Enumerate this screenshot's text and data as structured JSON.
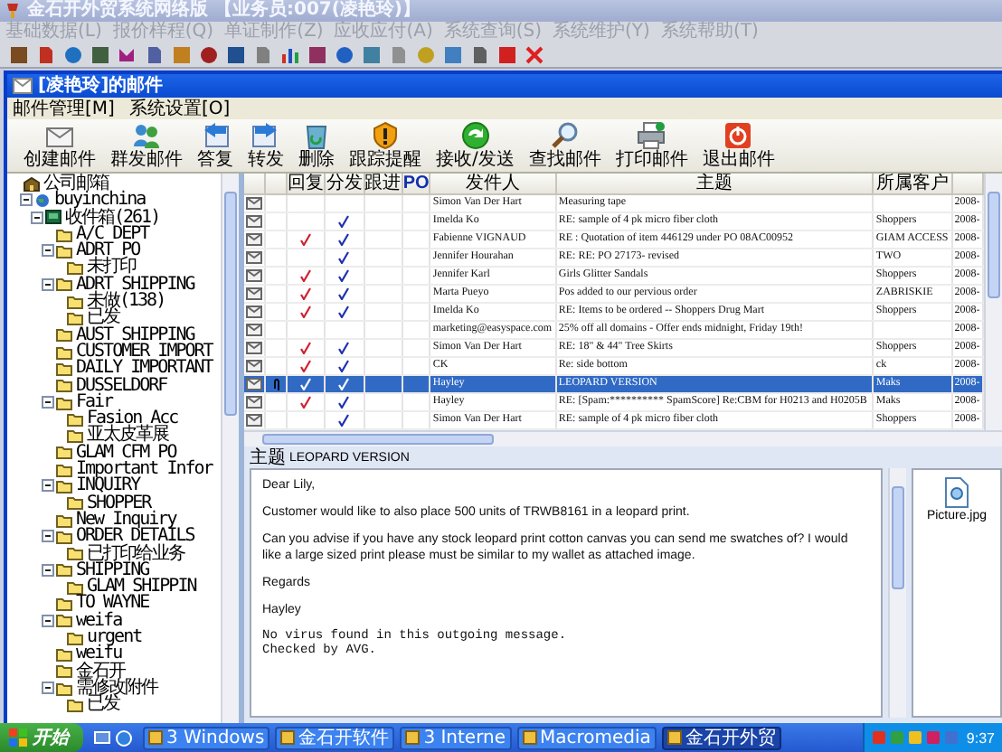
{
  "window": {
    "title": "金石开外贸系统网络版 【业务员:007(凌艳玲)】"
  },
  "menu": [
    {
      "label": "基础数据(L)",
      "disabled": true
    },
    {
      "label": "报价样程(Q)",
      "disabled": true
    },
    {
      "label": "单证制作(Z)",
      "disabled": true
    },
    {
      "label": "应收应付(A)",
      "disabled": true
    },
    {
      "label": "系统查询(S)",
      "disabled": true
    },
    {
      "label": "系统维护(Y)",
      "disabled": true
    },
    {
      "label": "系统帮助(T)",
      "disabled": true
    }
  ],
  "mail_window": {
    "title": "[凌艳玲]的邮件",
    "menu": [
      "邮件管理[M]",
      "系统设置[O]"
    ],
    "toolbar": [
      "创建邮件",
      "群发邮件",
      "答复",
      "转发",
      "删除",
      "跟踪提醒",
      "接收/发送",
      "查找邮件",
      "打印邮件",
      "退出邮件"
    ]
  },
  "tree": [
    {
      "label": "公司邮箱",
      "kind": "root",
      "children": [
        {
          "label": "buyinchina",
          "kind": "account",
          "expanded": true,
          "children": [
            {
              "label": "收件箱(261)",
              "kind": "inbox",
              "expanded": true,
              "children": [
                {
                  "label": "A/C DEPT",
                  "kind": "folder"
                },
                {
                  "label": "ADRT PO",
                  "kind": "folder",
                  "expanded": true,
                  "children": [
                    {
                      "label": "未打印",
                      "kind": "folder"
                    }
                  ]
                },
                {
                  "label": "ADRT SHIPPING",
                  "kind": "folder",
                  "expanded": true,
                  "children": [
                    {
                      "label": "未做(138)",
                      "kind": "folder"
                    },
                    {
                      "label": "已发",
                      "kind": "folder"
                    }
                  ]
                },
                {
                  "label": "AUST SHIPPING",
                  "kind": "folder"
                },
                {
                  "label": "CUSTOMER IMPORT",
                  "kind": "folder"
                },
                {
                  "label": "DAILY IMPORTANT",
                  "kind": "folder"
                },
                {
                  "label": "DUSSELDORF",
                  "kind": "folder"
                },
                {
                  "label": "Fair",
                  "kind": "folder",
                  "expanded": true,
                  "children": [
                    {
                      "label": "Fasion Acc",
                      "kind": "folder"
                    },
                    {
                      "label": "亚太皮革展",
                      "kind": "folder"
                    }
                  ]
                },
                {
                  "label": "GLAM CFM PO",
                  "kind": "folder"
                },
                {
                  "label": "Important Infor",
                  "kind": "folder"
                },
                {
                  "label": "INQUIRY",
                  "kind": "folder",
                  "expanded": true,
                  "children": [
                    {
                      "label": "SHOPPER",
                      "kind": "folder"
                    }
                  ]
                },
                {
                  "label": "New Inquiry",
                  "kind": "folder"
                },
                {
                  "label": "ORDER DETAILS",
                  "kind": "folder",
                  "expanded": true,
                  "children": [
                    {
                      "label": "已打印给业务",
                      "kind": "folder"
                    }
                  ]
                },
                {
                  "label": "SHIPPING",
                  "kind": "folder",
                  "expanded": true,
                  "children": [
                    {
                      "label": "GLAM SHIPPIN",
                      "kind": "folder"
                    }
                  ]
                },
                {
                  "label": "TO WAYNE",
                  "kind": "folder"
                },
                {
                  "label": "weifa",
                  "kind": "folder",
                  "expanded": true,
                  "children": [
                    {
                      "label": "urgent",
                      "kind": "folder"
                    }
                  ]
                },
                {
                  "label": "weifu",
                  "kind": "folder"
                },
                {
                  "label": "金石开",
                  "kind": "folder"
                },
                {
                  "label": "需修改附件",
                  "kind": "folder",
                  "expanded": true,
                  "children": [
                    {
                      "label": "已发",
                      "kind": "folder"
                    }
                  ]
                }
              ]
            }
          ]
        }
      ]
    }
  ],
  "table": {
    "columns": [
      "回复",
      "分发",
      "跟进",
      "PO",
      "发件人",
      "主题",
      "所属客户"
    ],
    "rows": [
      {
        "sender": "Simon Van Der Hart",
        "subject": "Measuring tape",
        "client": "",
        "date": "2008-",
        "replied": false,
        "distributed": false,
        "attachment": false,
        "selected": false
      },
      {
        "sender": "Imelda Ko",
        "subject": "RE: sample of  4 pk micro fiber cloth",
        "client": "Shoppers",
        "date": "2008-",
        "replied": false,
        "distributed": true,
        "attachment": false,
        "selected": false
      },
      {
        "sender": "Fabienne VIGNAUD",
        "subject": "RE : Quotation of item 446129 under PO 08AC00952",
        "client": "GIAM ACCESS",
        "date": "2008-",
        "replied": true,
        "distributed": true,
        "attachment": false,
        "selected": false
      },
      {
        "sender": "Jennifer Hourahan",
        "subject": "RE: RE: PO 27173- revised",
        "client": "TWO",
        "date": "2008-",
        "replied": false,
        "distributed": true,
        "attachment": false,
        "selected": false
      },
      {
        "sender": "Jennifer Karl",
        "subject": "Girls Glitter Sandals",
        "client": "Shoppers",
        "date": "2008-",
        "replied": true,
        "distributed": true,
        "attachment": false,
        "selected": false
      },
      {
        "sender": "Marta Pueyo",
        "subject": "Pos added to our pervious order",
        "client": "ZABRISKIE",
        "date": "2008-",
        "replied": true,
        "distributed": true,
        "attachment": false,
        "selected": false
      },
      {
        "sender": "Imelda Ko",
        "subject": "RE: Items to be ordered -- Shoppers Drug Mart",
        "client": "Shoppers",
        "date": "2008-",
        "replied": true,
        "distributed": true,
        "attachment": false,
        "selected": false
      },
      {
        "sender": "marketing@easyspace.com",
        "subject": "25% off all domains - Offer ends midnight, Friday 19th!",
        "client": "",
        "date": "2008-",
        "replied": false,
        "distributed": false,
        "attachment": false,
        "selected": false
      },
      {
        "sender": "Simon Van Der Hart",
        "subject": "RE: 18\" & 44\" Tree Skirts",
        "client": "Shoppers",
        "date": "2008-",
        "replied": true,
        "distributed": true,
        "attachment": false,
        "selected": false
      },
      {
        "sender": "CK",
        "subject": "Re: side bottom",
        "client": "ck",
        "date": "2008-",
        "replied": true,
        "distributed": true,
        "attachment": false,
        "selected": false
      },
      {
        "sender": "Hayley",
        "subject": "LEOPARD VERSION",
        "client": "Maks",
        "date": "2008-",
        "replied": true,
        "distributed": true,
        "attachment": true,
        "selected": true
      },
      {
        "sender": "Hayley",
        "subject": "RE: [Spam:********** SpamScore] Re:CBM for H0213 and H0205B",
        "client": "Maks",
        "date": "2008-",
        "replied": true,
        "distributed": true,
        "attachment": false,
        "selected": false
      },
      {
        "sender": "Simon Van Der Hart",
        "subject": "RE: sample of  4 pk micro fiber cloth",
        "client": "Shoppers",
        "date": "2008-",
        "replied": false,
        "distributed": true,
        "attachment": false,
        "selected": false
      }
    ]
  },
  "preview": {
    "subject_label": "主题",
    "subject": "LEOPARD VERSION",
    "paragraphs": [
      "Dear Lily,",
      "Customer would like to also place 500 units of TRWB8161 in a leopard print.",
      "Can you advise if you have any stock leopard print cotton canvas you can send me swatches of? I would like a large sized print please must be similar to my wallet as attached image.",
      "Regards",
      "Hayley"
    ],
    "signature": [
      "No virus found in this outgoing message.",
      "Checked by AVG."
    ],
    "attachments": [
      "Picture.jpg"
    ]
  },
  "taskbar": {
    "start": "开始",
    "tasks": [
      {
        "label": "3 Windows",
        "selected": false
      },
      {
        "label": "金石开软件",
        "selected": false
      },
      {
        "label": "3 Interne",
        "selected": false
      },
      {
        "label": "Macromedia",
        "selected": false
      },
      {
        "label": "金石开外贸",
        "selected": true
      }
    ],
    "clock": "9:37"
  }
}
